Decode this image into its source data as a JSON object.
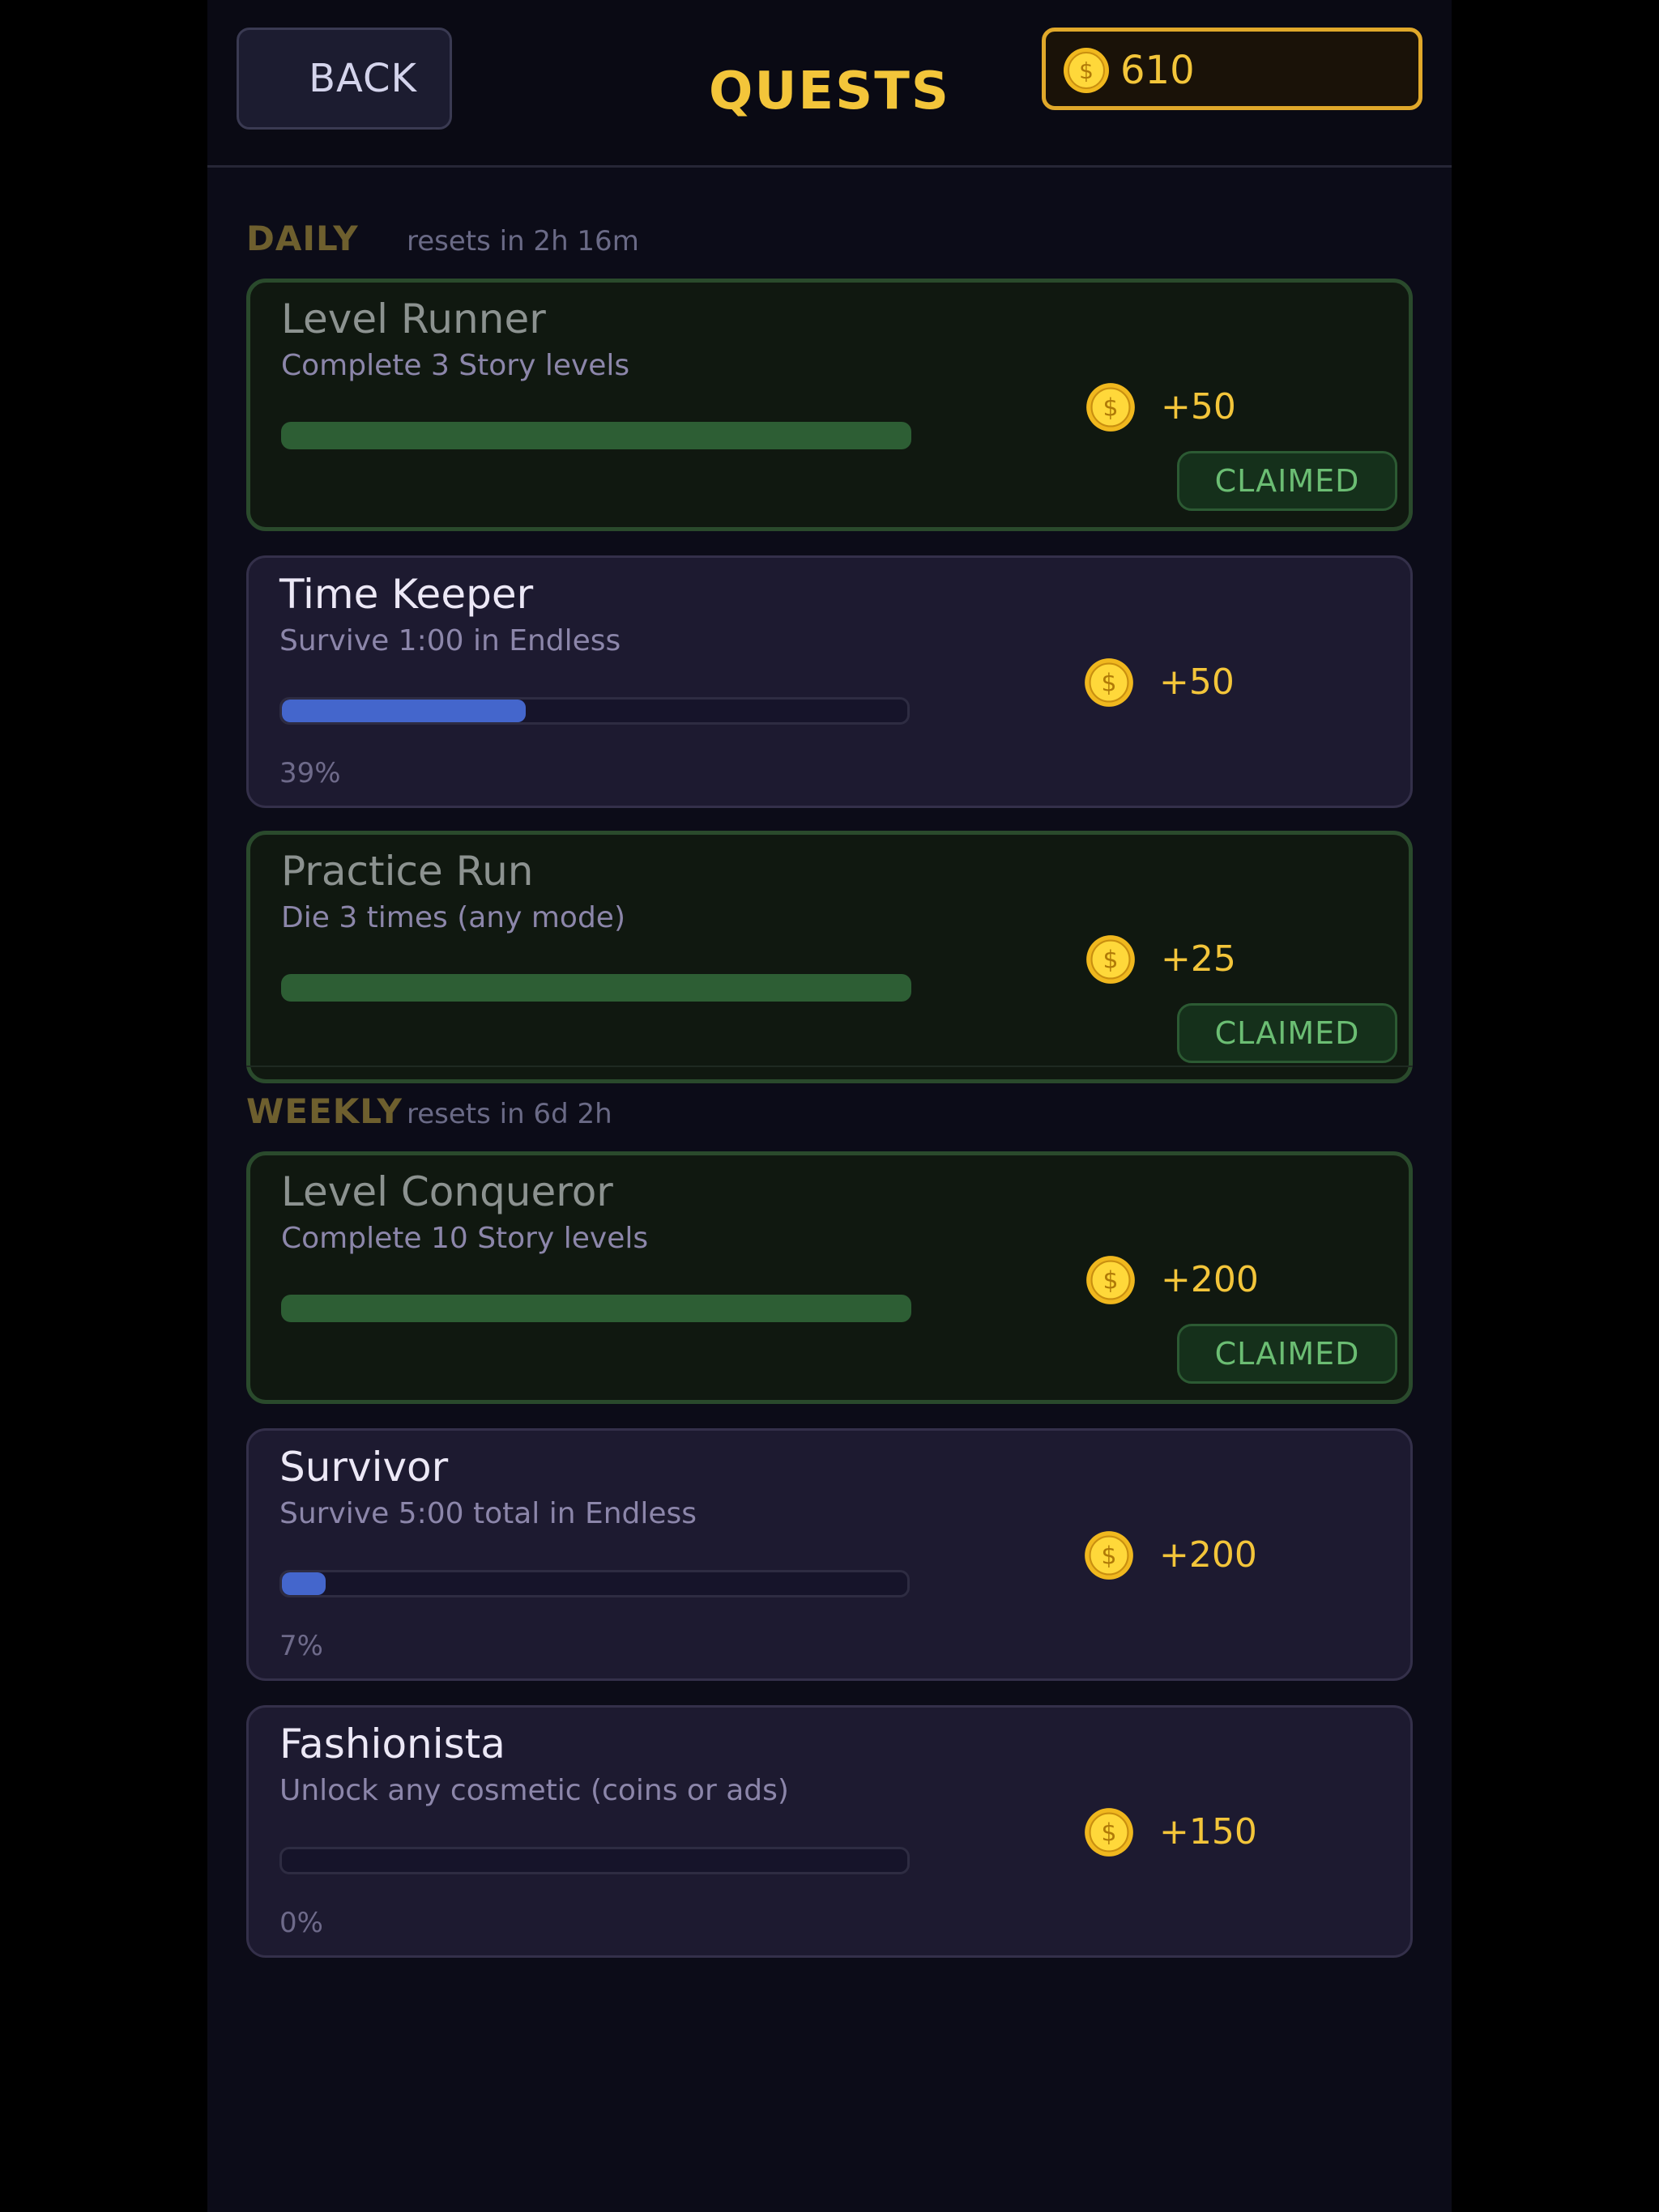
{
  "header": {
    "back_label": "BACK",
    "title": "QUESTS",
    "coin_balance": "610",
    "coin_symbol": "$"
  },
  "sections": {
    "daily": {
      "label": "DAILY",
      "reset": "resets in 2h 16m"
    },
    "weekly": {
      "label": "WEEKLY",
      "reset": "resets in 6d 2h"
    }
  },
  "quests": [
    {
      "title": "Level Runner",
      "desc": "Complete 3 Story levels",
      "reward": "+50",
      "claimed": true,
      "claimed_label": "CLAIMED",
      "progress": 1.0
    },
    {
      "title": "Time Keeper",
      "desc": "Survive 1:00 in Endless",
      "reward": "+50",
      "claimed": false,
      "progress": 0.39,
      "progress_label": "39%"
    },
    {
      "title": "Practice Run",
      "desc": "Die 3 times (any mode)",
      "reward": "+25",
      "claimed": true,
      "claimed_label": "CLAIMED",
      "progress": 1.0
    },
    {
      "title": "Level Conqueror",
      "desc": "Complete 10 Story levels",
      "reward": "+200",
      "claimed": true,
      "claimed_label": "CLAIMED",
      "progress": 1.0
    },
    {
      "title": "Survivor",
      "desc": "Survive 5:00 total in Endless",
      "reward": "+200",
      "claimed": false,
      "progress": 0.07,
      "progress_label": "7%"
    },
    {
      "title": "Fashionista",
      "desc": "Unlock any cosmetic (coins or ads)",
      "reward": "+150",
      "claimed": false,
      "progress": 0.0,
      "progress_label": "0%"
    }
  ],
  "colors": {
    "gold": "#f3c53a",
    "progress_blue": "#4466cc",
    "claimed_green": "#6bbd73"
  },
  "icons": {
    "coin": "gold-coin-icon"
  }
}
